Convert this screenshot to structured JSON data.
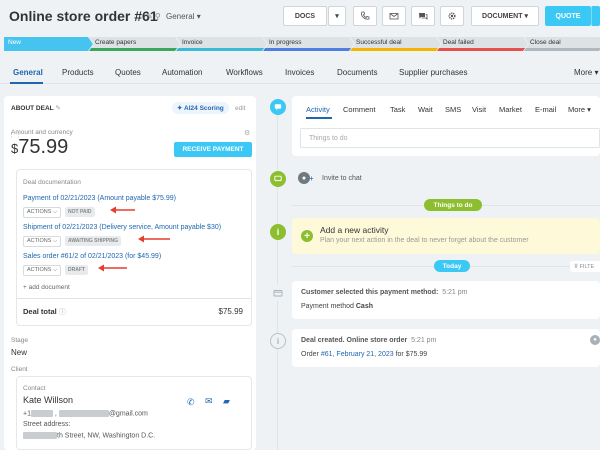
{
  "header": {
    "title": "Online store order #61",
    "category": "General",
    "buttons": {
      "docs": "DOCS",
      "document": "DOCUMENT",
      "quote": "QUOTE"
    }
  },
  "stages": [
    "New",
    "Create papers",
    "Invoice",
    "In progress",
    "Successful deal",
    "Deal failed",
    "Close deal"
  ],
  "stage_colors": [
    "#47c3f0",
    "#39a85c",
    "#3bbad8",
    "#4e7fe0",
    "#f6b400",
    "#e8504d",
    "#b0b8bd"
  ],
  "tabs": [
    "General",
    "Products",
    "Quotes",
    "Automation",
    "Workflows",
    "Invoices",
    "Documents",
    "Supplier purchases",
    "More"
  ],
  "about": {
    "title": "ABOUT DEAL",
    "ai_scoring": "AI24 Scoring",
    "edit": "edit",
    "amount_label": "Amount and currency",
    "currency": "$",
    "amount": "75.99",
    "receive_payment": "RECEIVE PAYMENT",
    "doc_title": "Deal documentation",
    "documents": [
      {
        "link": "Payment of 02/21/2023 (Amount payable $75.99)",
        "actions": "ACTIONS",
        "status": "NOT PAID"
      },
      {
        "link": "Shipment of 02/21/2023 (Delivery service, Amount payable $30)",
        "actions": "ACTIONS",
        "status": "AWAITING SHIPPING"
      },
      {
        "link": "Sales order #61/2 of 02/21/2023 (for $45.99)",
        "actions": "ACTIONS",
        "status": "DRAFT"
      }
    ],
    "add_document": "+ add document",
    "deal_total_label": "Deal total",
    "deal_total": "$75.99",
    "stage_label": "Stage",
    "stage_value": "New",
    "client_label": "Client",
    "contact_label": "Contact",
    "contact_name": "Kate Willson",
    "phone_prefix": "+1",
    "email_suffix": "@gmail.com",
    "street_label": "Street address:",
    "street_value": "th Street, NW, Washington D.C."
  },
  "activity": {
    "tabs": [
      "Activity",
      "Comment",
      "Task",
      "Wait",
      "SMS",
      "Visit",
      "Market",
      "E-mail",
      "More"
    ],
    "placeholder": "Things to do"
  },
  "timeline": {
    "invite": "Invite to chat",
    "things_to_do": "Things to do",
    "new_activity_title": "Add a new activity",
    "new_activity_desc": "Plan your next action in the deal to never forget about the customer",
    "today": "Today",
    "filter": "FILTE",
    "payment_title": "Customer selected this payment method:",
    "payment_time": "5:21 pm",
    "payment_method_label": "Payment method",
    "payment_method_value": "Cash",
    "deal_created_title": "Deal created. Online store order",
    "deal_created_time": "5:21 pm",
    "order_label": "Order",
    "order_link": "#61, February 21, 2023",
    "order_amount": "for $75.99"
  }
}
